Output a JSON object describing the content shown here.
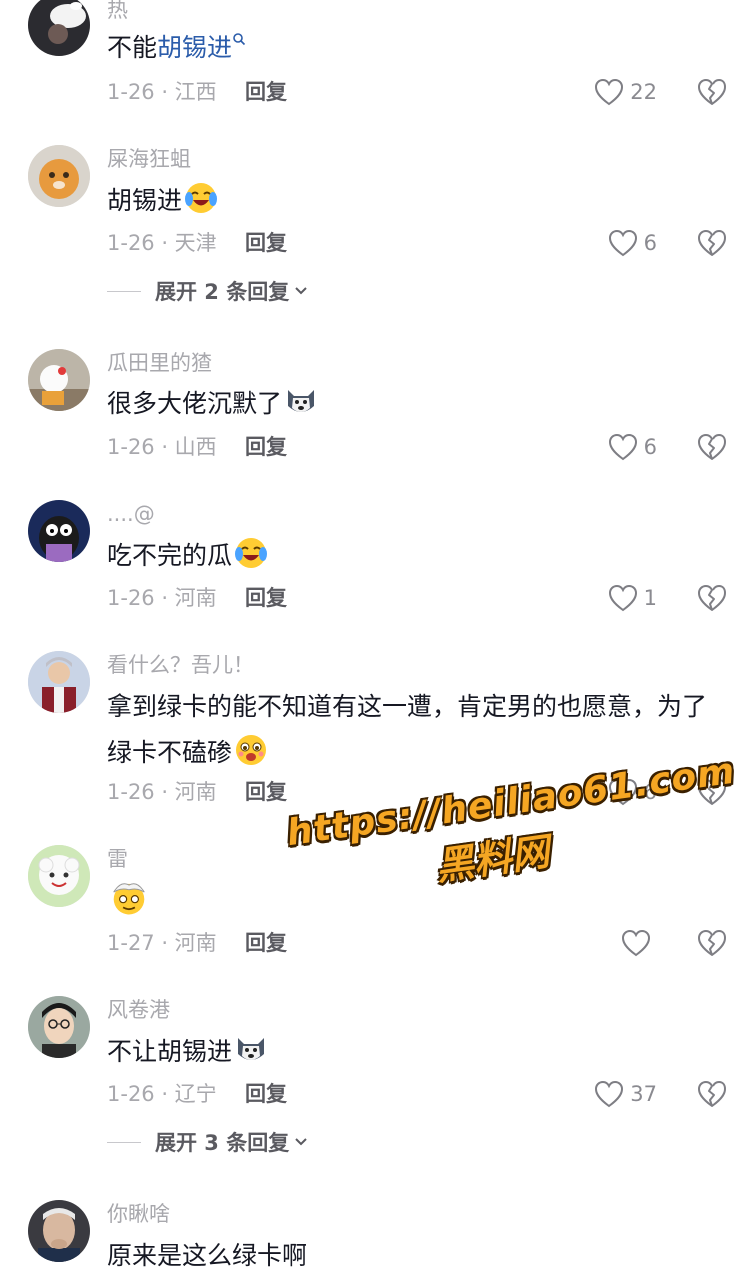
{
  "comments": [
    {
      "username": "热",
      "text_plain": "不能",
      "text_link": "胡锡进",
      "date_region": "1-26 · 江西",
      "reply_label": "回复",
      "likes": "22",
      "avatar_icon": "cat-avatar"
    },
    {
      "username": "屎海狂蛆",
      "text_plain": "胡锡进",
      "emoji": "laughing-tears-emoji",
      "date_region": "1-26 · 天津",
      "reply_label": "回复",
      "likes": "6",
      "expand_label": "展开 2 条回复",
      "avatar_icon": "orange-cat-avatar"
    },
    {
      "username": "瓜田里的猹",
      "text_plain": "很多大佬沉默了",
      "emoji": "husky-emoji",
      "date_region": "1-26 · 山西",
      "reply_label": "回复",
      "likes": "6",
      "avatar_icon": "hello-kitty-avatar"
    },
    {
      "username": "....@",
      "text_plain": "吃不完的瓜",
      "emoji": "laughing-tears-emoji",
      "date_region": "1-26 · 河南",
      "reply_label": "回复",
      "likes": "1",
      "avatar_icon": "patrick-avatar"
    },
    {
      "username": "看什么？吾儿！",
      "text_plain": "拿到绿卡的能不知道有这一遭，肯定男的也愿意，为了绿卡不磕碜",
      "emoji": "drooling-emoji",
      "date_region": "1-26 · 河南",
      "reply_label": "回复",
      "likes": "6",
      "avatar_icon": "costume-person-avatar"
    },
    {
      "username": "雷",
      "text_plain": "",
      "emoji": "sheep-emoji",
      "date_region": "1-27 · 河南",
      "reply_label": "回复",
      "likes": "",
      "avatar_icon": "sheep-avatar"
    },
    {
      "username": "风卷港",
      "text_plain": "不让胡锡进",
      "emoji": "husky-emoji",
      "date_region": "1-26 · 辽宁",
      "reply_label": "回复",
      "likes": "37",
      "expand_label": "展开 3 条回复",
      "avatar_icon": "glasses-man-avatar"
    },
    {
      "username": "你瞅啥",
      "text_plain": "原来是这么绿卡啊",
      "avatar_icon": "old-man-avatar"
    }
  ],
  "watermark": {
    "line1": "https://heiliao61.com",
    "line2": "黑料网"
  },
  "colors": {
    "link": "#2b5caa",
    "muted": "#a8a8ad",
    "watermark": "#f5a623"
  }
}
